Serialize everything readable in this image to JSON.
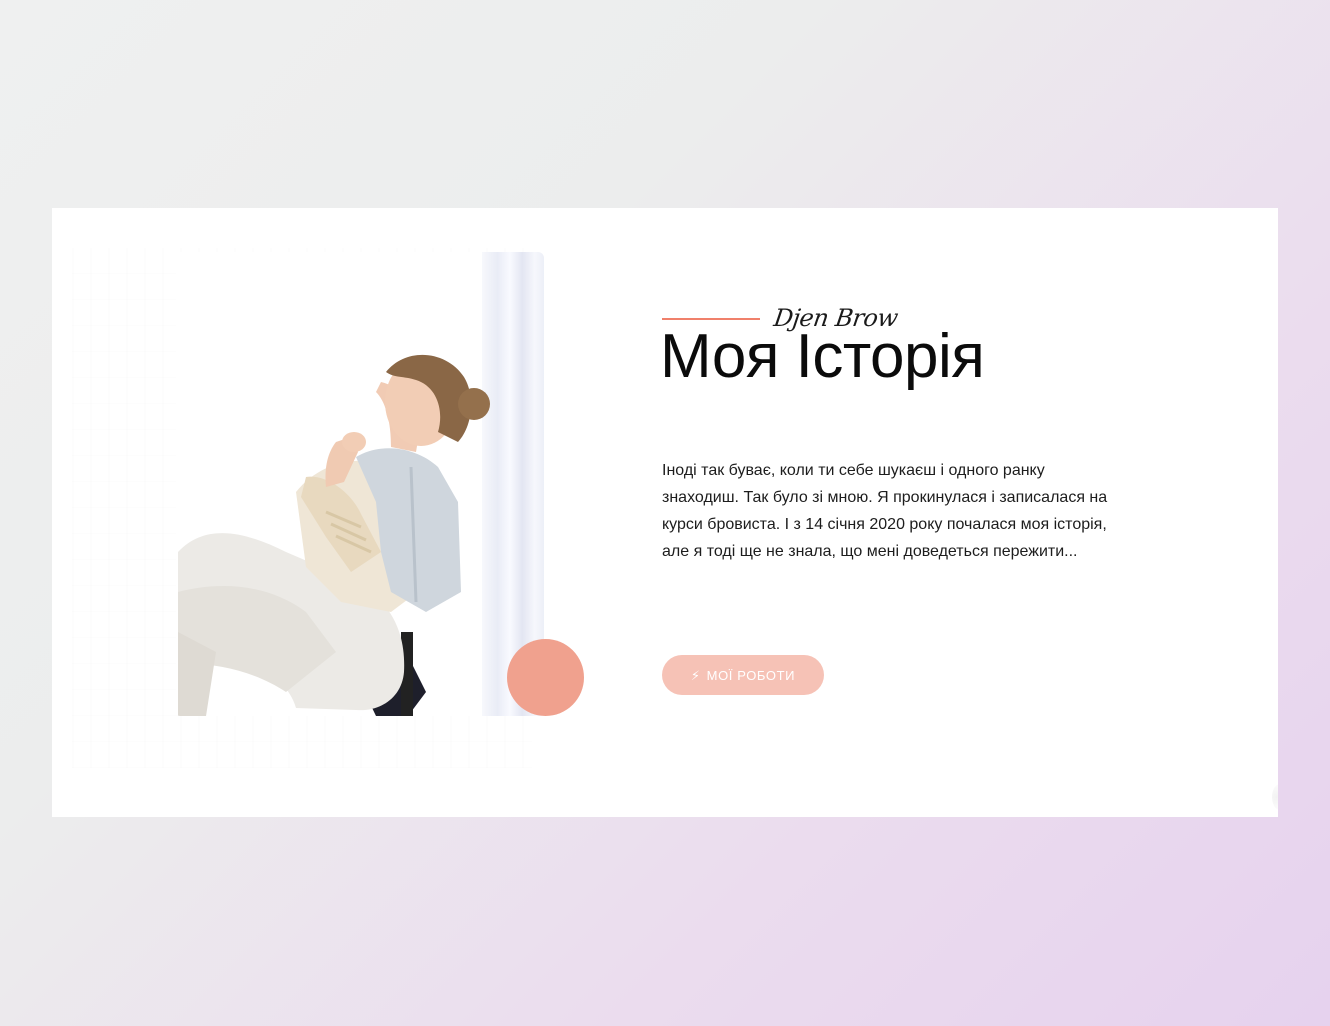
{
  "section": {
    "script_label": "Djen Brow",
    "title": "Моя Історія",
    "paragraph": "Іноді так буває, коли ти себе шукаєш і одного ранку знаходиш. Так було зі мною. Я прокинулася і записалася на курси бровиста. І з 14 січня 2020 року почалася моя історія, але я тоді ще не знала, що мені доведеться пережити...",
    "button_label": "Мої роботи",
    "button_icon": "bolt-icon"
  },
  "colors": {
    "accent_line": "#f0806b",
    "accent_circle": "#f0a18e",
    "button_bg": "#f6c2b6",
    "title": "#0b0b0b"
  }
}
